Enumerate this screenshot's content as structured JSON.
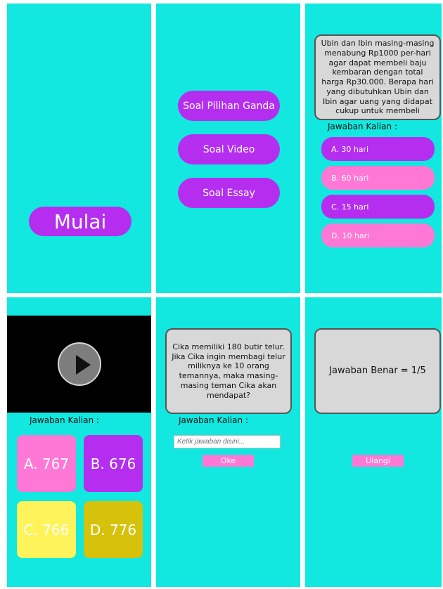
{
  "screen1": {
    "start_label": "Mulai"
  },
  "screen2": {
    "buttons": [
      "Soal Pilihan Ganda",
      "Soal Video",
      "Soal Essay"
    ]
  },
  "screen3": {
    "question": "Ubin dan Ibin masing-masing menabung Rp1000 per-hari agar dapat membeli baju kembaran dengan total harga Rp30.000. Berapa hari yang dibutuhkan Ubin dan Ibin agar uang yang didapat cukup untuk membeli",
    "answer_label": "Jawaban Kalian :",
    "options": [
      "A. 30 hari",
      "B. 60 hari",
      "C. 15 hari",
      "D. 10 hari"
    ]
  },
  "screen4": {
    "answer_label": "Jawaban Kalian :",
    "options": [
      "A. 767",
      "B. 676",
      "C. 766",
      "D. 776"
    ]
  },
  "screen5": {
    "question": "Cika memiliki 180 butir telur. Jika Cika ingin membagi telur miliknya ke 10 orang temannya, maka masing-masing teman Cika akan mendapat?",
    "answer_label": "Jawaban Kalian :",
    "input_placeholder": "Ketik jawaban disini...",
    "ok_label": "Oke"
  },
  "screen6": {
    "result_text": "Jawaban Benar = 1/5",
    "retry_label": "Ulangi"
  },
  "colors": {
    "background": "#12e8df",
    "purple": "#b52ef0",
    "pink": "#ff78d6",
    "yellow": "#fff35b",
    "olive": "#d6c10b"
  },
  "icons": {
    "video_play": "play-icon"
  }
}
